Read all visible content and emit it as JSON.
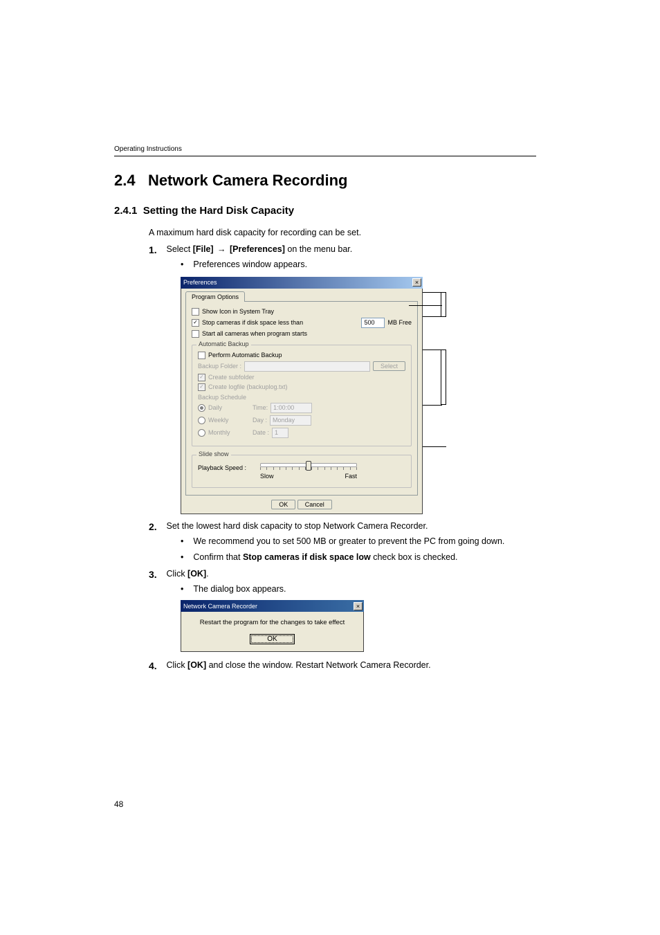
{
  "running_head": "Operating Instructions",
  "title_num": "2.4",
  "title": "Network Camera Recording",
  "subtitle_num": "2.4.1",
  "subtitle": "Setting the Hard Disk Capacity",
  "intro": "A maximum hard disk capacity for recording can be set.",
  "steps": {
    "s1": {
      "num": "1.",
      "prefix": "Select ",
      "file": "[File]",
      "mid": " ",
      "prefs": "[Preferences]",
      "suffix": " on the menu bar."
    },
    "s1b1": "Preferences window appears.",
    "s2": {
      "num": "2.",
      "text": "Set the lowest hard disk capacity to stop Network Camera Recorder."
    },
    "s2b1": "We recommend you to set 500 MB or greater to prevent the PC from going down.",
    "s2b2_a": "Confirm that ",
    "s2b2_strong": "Stop cameras if disk space low",
    "s2b2_b": " check box is checked.",
    "s3": {
      "num": "3.",
      "prefix": "Click ",
      "ok": "[OK]",
      "suffix": "."
    },
    "s3b1": "The dialog box appears.",
    "s4": {
      "num": "4.",
      "prefix": "Click ",
      "ok": "[OK]",
      "suffix": " and close the window. Restart Network Camera Recorder."
    }
  },
  "prefs": {
    "title": "Preferences",
    "tab": "Program Options",
    "show_tray": "Show Icon in System Tray",
    "stop_cameras": "Stop cameras if disk space less than",
    "mb_value": "500",
    "mb_free": "MB Free",
    "start_all": "Start all cameras when program starts",
    "backup_group": "Automatic Backup",
    "perform_backup": "Perform Automatic Backup",
    "backup_folder_label": "Backup Folder :",
    "select_btn": "Select",
    "create_subfolder": "Create subfolder",
    "create_log_file": "Create logfile (backuplog.txt)",
    "schedule_label": "Backup Schedule",
    "daily": "Daily",
    "weekly": "Weekly",
    "monthly": "Monthly",
    "time_label": "Time:",
    "time_value": "1:00:00",
    "day_label": "Day :",
    "day_value": "Monday",
    "date_label": "Date :",
    "date_value": "1",
    "slideshow_group": "Slide show",
    "playback_label": "Playback Speed :",
    "slow": "Slow",
    "fast": "Fast",
    "ok": "OK",
    "cancel": "Cancel"
  },
  "msgbox": {
    "title": "Network Camera Recorder",
    "msg": "Restart the program for the changes to take effect",
    "ok": "OK"
  },
  "page_number": "48"
}
